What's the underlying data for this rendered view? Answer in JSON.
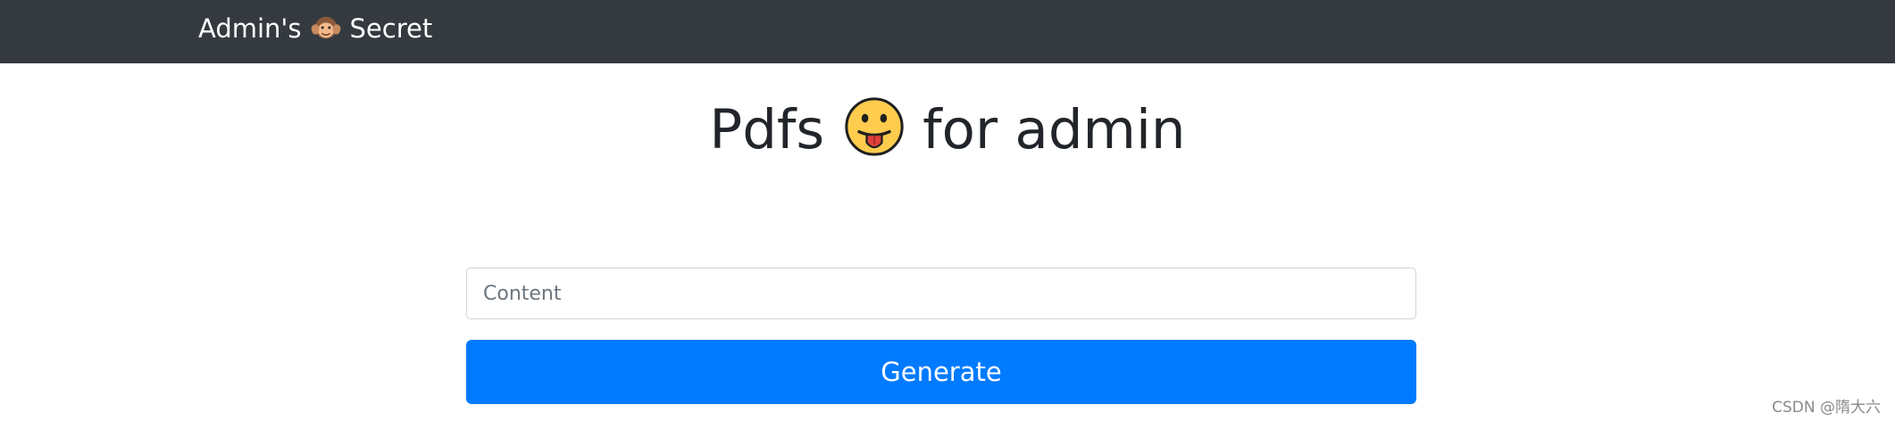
{
  "navbar": {
    "brand_prefix": "Admin's",
    "brand_suffix": "Secret",
    "brand_icon": "hear-no-evil-monkey-icon"
  },
  "main": {
    "heading_prefix": "Pdfs",
    "heading_suffix": "for admin",
    "heading_icon": "tongue-out-face-icon",
    "content_input": {
      "placeholder": "Content",
      "value": ""
    },
    "generate_label": "Generate"
  },
  "watermark": "CSDN @隋大六",
  "colors": {
    "navbar_bg": "#343a40",
    "primary": "#007bff",
    "text": "#212529"
  }
}
